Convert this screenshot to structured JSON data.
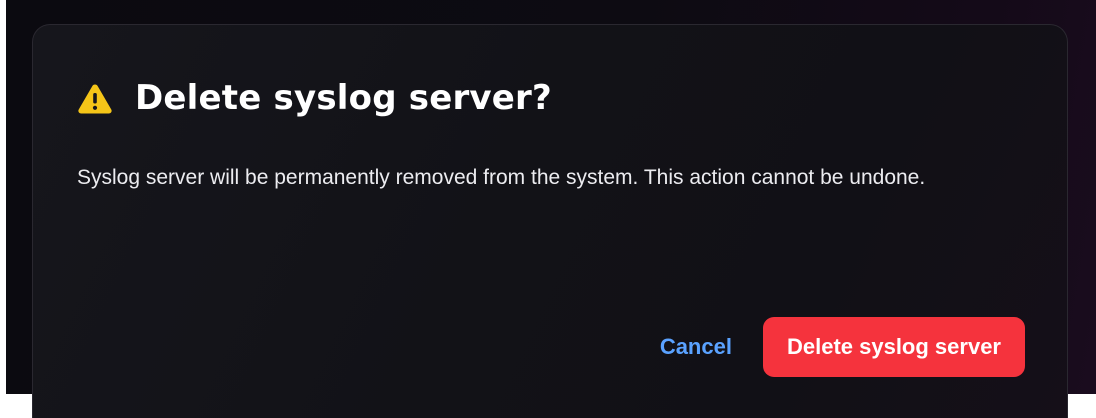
{
  "dialog": {
    "icon": "warning-triangle-icon",
    "icon_color": "#f5c518",
    "title": "Delete syslog server?",
    "message": "Syslog server will be permanently removed from the system. This action cannot be undone.",
    "cancel_label": "Cancel",
    "confirm_label": "Delete syslog server",
    "accent_cancel": "#5aa2ff",
    "accent_danger": "#f5333d"
  }
}
